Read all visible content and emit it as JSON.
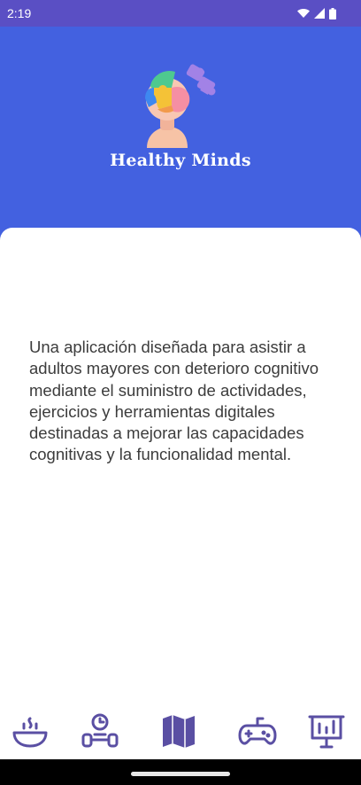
{
  "status_bar": {
    "time": "2:19",
    "icons": [
      "wifi-icon",
      "signal-icon",
      "battery-icon"
    ]
  },
  "header": {
    "brand_name": "Healthy Minds",
    "logo_icon": "puzzle-head-icon",
    "background_color": "#4361e0"
  },
  "main": {
    "description": "Una aplicación diseñada para asistir a adultos mayores con deterioro cognitivo mediante el suministro de actividades, ejercicios y herramientas digitales destinadas a mejorar las capacidades cognitivas y la funcionalidad mental."
  },
  "bottom_nav": {
    "accent_color": "#5a4fa3",
    "items": [
      {
        "icon": "food-bowl-icon"
      },
      {
        "icon": "exercise-icon"
      },
      {
        "icon": "map-icon"
      },
      {
        "icon": "gamepad-icon"
      },
      {
        "icon": "presentation-chart-icon"
      }
    ]
  }
}
